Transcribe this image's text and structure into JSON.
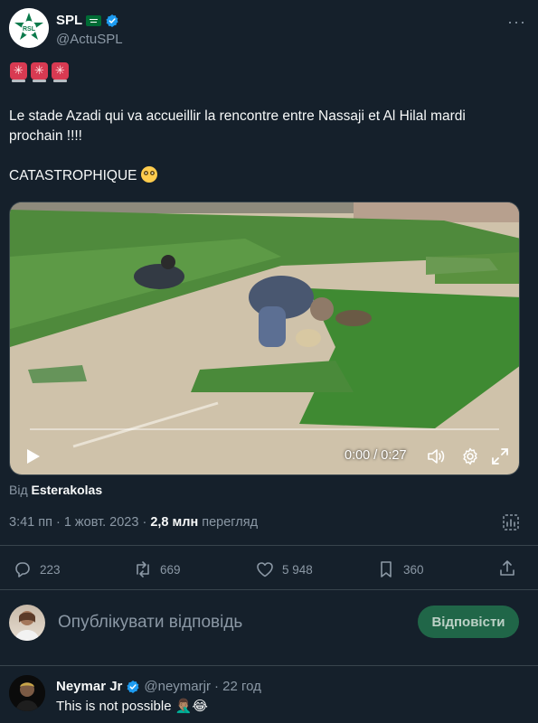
{
  "account": {
    "name": "SPL",
    "handle": "@ActuSPL",
    "more_label": "···",
    "flag_icon": "saudi-flag-icon",
    "verified_icon": "verified-badge-icon"
  },
  "tweet": {
    "sirens": [
      "🚨",
      "🚨",
      "🚨"
    ],
    "line1": "Le stade Azadi qui va accueillir la rencontre entre Nassaji et Al Hilal mardi prochain !!!!",
    "line2": "CATASTROPHIQUE",
    "emoji": "flushed-face-icon"
  },
  "video": {
    "time": "0:00 / 0:27",
    "progress": 0.0,
    "controls": [
      "play-icon",
      "volume-icon",
      "settings-icon",
      "fullscreen-icon"
    ]
  },
  "source": {
    "prefix": "Від",
    "name": "Esterakolas"
  },
  "meta": {
    "datetime": "3:41 пп · 1 жовт. 2023 ·",
    "views": "2,8 млн",
    "views_label": "перегляд"
  },
  "actions": {
    "replies": "223",
    "retweets": "669",
    "likes": "5 948",
    "bookmarks": "360"
  },
  "reply_box": {
    "placeholder": "Опублікувати відповідь",
    "button": "Відповісти"
  },
  "reply": {
    "name": "Neymar Jr",
    "handle": "@neymarjr",
    "time": "· 22 год",
    "text": "This is not possible 🤦🏽‍♂️😂"
  },
  "colors": {
    "background": "#15202b",
    "reply_button": "#206648",
    "verified": "#1d9bf0",
    "muted": "#8b98a5"
  }
}
